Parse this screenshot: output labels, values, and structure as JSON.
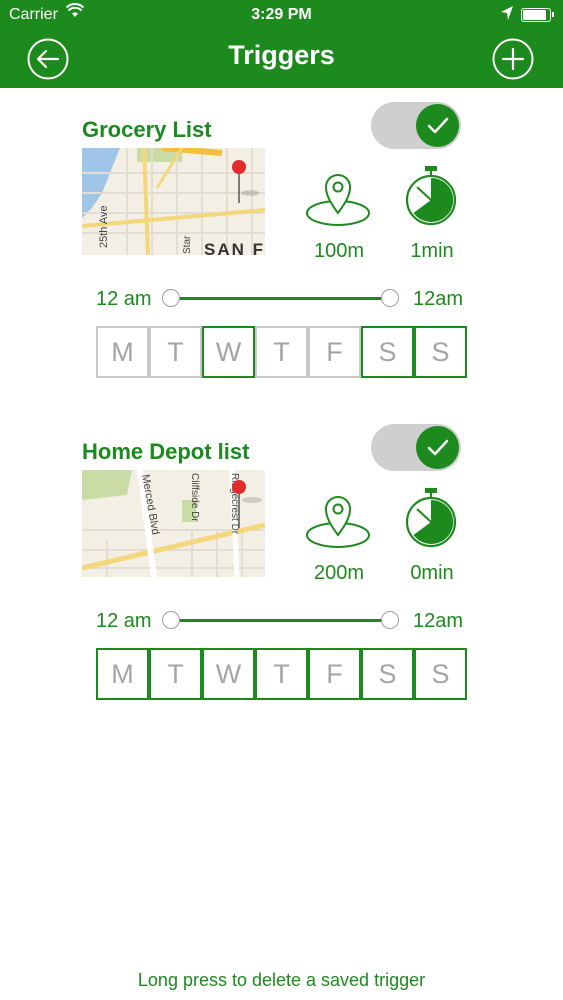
{
  "status_bar": {
    "carrier": "Carrier",
    "time": "3:29 PM",
    "battery_level": 0.9
  },
  "header": {
    "title": "Triggers",
    "back_icon": "back-arrow-icon",
    "add_icon": "plus-icon"
  },
  "triggers": [
    {
      "name": "Grocery List",
      "enabled": true,
      "radius": "100m",
      "delay": "1min",
      "slider": {
        "start_label": "12 am",
        "end_label": "12am"
      },
      "map_labels": [
        "25th Ave",
        "Star",
        "SAN F"
      ],
      "days": [
        {
          "label": "M",
          "active": false
        },
        {
          "label": "T",
          "active": false
        },
        {
          "label": "W",
          "active": true
        },
        {
          "label": "T",
          "active": false
        },
        {
          "label": "F",
          "active": false
        },
        {
          "label": "S",
          "active": true
        },
        {
          "label": "S",
          "active": true
        }
      ]
    },
    {
      "name": "Home Depot list",
      "enabled": true,
      "radius": "200m",
      "delay": "0min",
      "slider": {
        "start_label": "12 am",
        "end_label": "12am"
      },
      "map_labels": [
        "Merced Blvd",
        "Cliffside Dr",
        "Ridgecrest Dr"
      ],
      "days": [
        {
          "label": "M",
          "active": true
        },
        {
          "label": "T",
          "active": true
        },
        {
          "label": "W",
          "active": true
        },
        {
          "label": "T",
          "active": true
        },
        {
          "label": "F",
          "active": true
        },
        {
          "label": "S",
          "active": true
        },
        {
          "label": "S",
          "active": true
        }
      ]
    }
  ],
  "footer": {
    "hint": "Long press to delete a saved trigger"
  },
  "colors": {
    "accent": "#1d8a1d",
    "inactive_border": "#c9c9c9",
    "toggle_track": "#cfcfcf"
  }
}
